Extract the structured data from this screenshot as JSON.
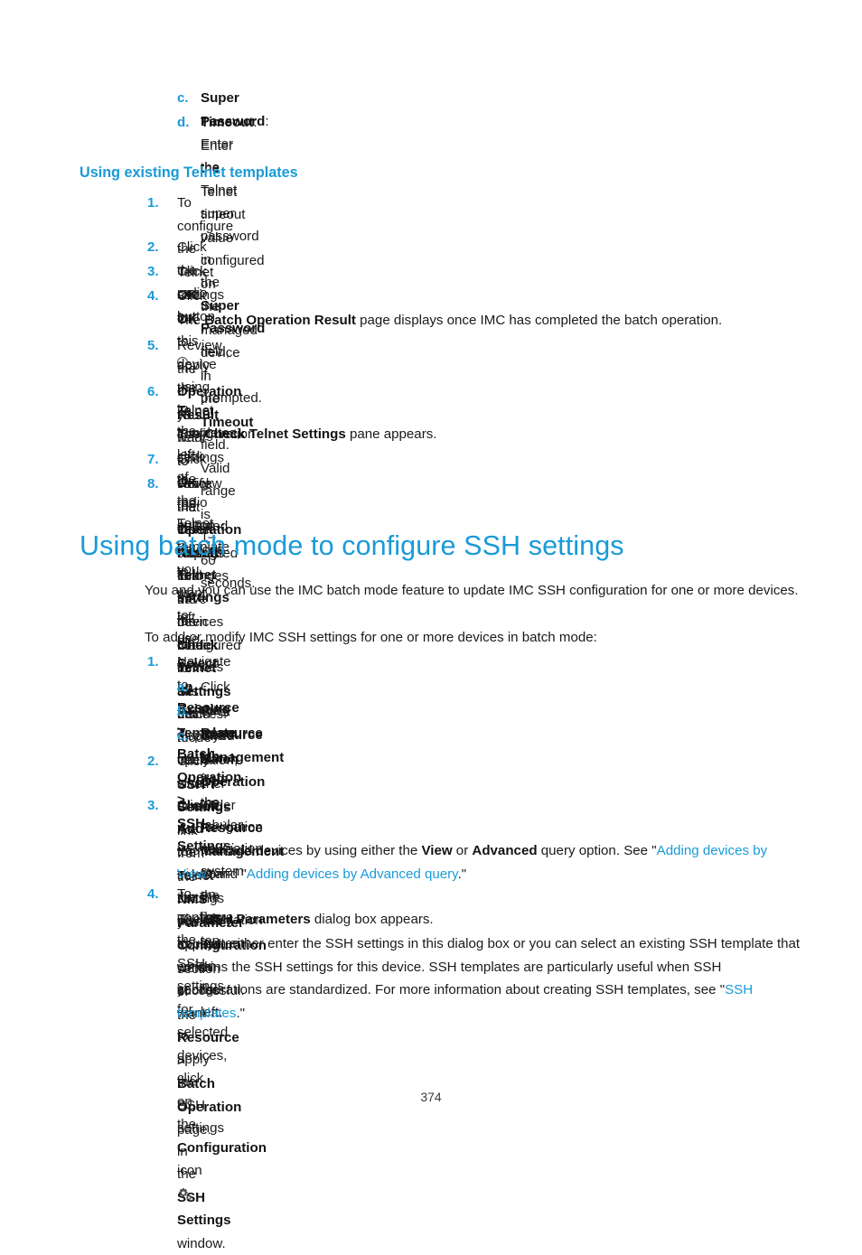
{
  "page": {
    "number": "374"
  },
  "sections": {
    "telnet_sub_items": {
      "c": {
        "marker": "c.",
        "lead": "Super Password",
        "text_1": ": Enter the Telnet super password in the ",
        "bold_2": "Super Password",
        "text_3": " field, if prompted."
      },
      "d": {
        "marker": "d.",
        "lead": "Timeout",
        "text_1": ": Enter the Telnet timeout value configured on the managed device in the ",
        "bold_2": "Timeout",
        "text_3": " field. Valid range is 1–60 seconds."
      }
    },
    "telnet_templates": {
      "heading": "Using existing Telnet templates",
      "items": {
        "i1": {
          "marker": "1.",
          "text_1": "To configure the Telnet settings for this device using Telnet templates, click the radio button",
          "icon": "radio-button-icon",
          "text_2": "to the left of ",
          "bold_3": "Select an Existing Template",
          "text_4": "."
        },
        "i2": {
          "marker": "2.",
          "text_1": "Click the radio button",
          "icon": "radio-button-icon",
          "text_2": "to the left of the Telnet template you want to use."
        },
        "i3": {
          "marker": "3.",
          "text_1": "Click ",
          "bold_2": "OK",
          "text_3": "."
        },
        "i4": {
          "marker": "4.",
          "text_1": "Click ",
          "bold_2": "OK",
          "text_3": " to apply the Telnet configuration settings to the selected devices."
        },
        "i4_note": {
          "text_1": "The ",
          "bold_2": "Batch Operation Result",
          "text_3": " page displays once IMC has completed the batch operation."
        },
        "i5": {
          "marker": "5.",
          "text_1": "Review the ",
          "bold_2": "Operation Result",
          "text_3": " field to verify that the requested changes have been made for all devices."
        },
        "i6": {
          "marker": "6.",
          "text_1": "If you want to check the Telnet settings for the devices configured in this batch mode operation, click ",
          "bold_2": "Check",
          "text_3": "."
        },
        "i6_note": {
          "text_1": "The ",
          "bold_2": "Check Telnet Settings",
          "text_3": " pane appears."
        },
        "i7": {
          "marker": "7.",
          "text_1": "Click ",
          "bold_2": "OK",
          "text_3": " to check the ",
          "bold_4": "Telnet settings",
          "text_5": " for all devices in the displayed list."
        },
        "i8": {
          "marker": "8.",
          "text_1": "Review the ",
          "bold_2": "Operation Result",
          "text_3": " field in the ",
          "bold_4": "Check Telnet Settings",
          "text_5": " List to verify whether or not the Telnet settings you applied were successful."
        }
      }
    },
    "ssh_batch": {
      "heading": "Using batch mode to configure SSH settings",
      "intro_1": "You and you can use the IMC batch mode feature to update IMC SSH configuration for one or more devices.",
      "intro_2": "To add or modify IMC SSH settings for one or more devices in batch mode:",
      "items": {
        "i1": {
          "marker": "1.",
          "text_1": "Navigate to ",
          "bold_2": "Resource > Batch Operation > SSH Settings",
          "text_3": ":"
        },
        "i1a": {
          "marker": "a.",
          "text_1": "Click the ",
          "bold_2": "Resource",
          "text_3": " tab from the tabular navigation system on the top."
        },
        "i1b": {
          "marker": "b.",
          "text_1": "Click ",
          "bold_2": "Resource Management",
          "text_3": " on the navigation tree on the left."
        },
        "i1c": {
          "marker": "c.",
          "text_1": "Click ",
          "bold_2": "Batch Operation",
          "text_3": " under ",
          "bold_4": "Resource Management",
          "text_5": " from the navigation system on the left."
        },
        "i2": {
          "marker": "2.",
          "text_1": "Click ",
          "bold_2": "SSH Settings",
          "text_3": " link from the ",
          "bold_4": "NMS Parameter Configuration",
          "text_5": " section of the ",
          "bold_6": "Resource > Batch Operation",
          "text_7": " page."
        },
        "i3": {
          "marker": "3.",
          "text_1": "Click ",
          "bold_2": "Add",
          "text_3": " to select the devices to which you want to apply the SSH settings in the ",
          "bold_4": "SSH Settings",
          "text_5": " window."
        },
        "i3_note": {
          "text_1": "You can add devices by using either the ",
          "bold_2": "View",
          "text_3": " or ",
          "bold_4": "Advanced",
          "text_5": " query option. See \"",
          "link_6": "Adding devices by View",
          "text_7": "\" and \"",
          "link_8": "Adding devices by Advanced query",
          "text_9": ".\""
        },
        "i4": {
          "marker": "4.",
          "text_1": "To configure the SSH settings for selected devices, click on the ",
          "bold_2": "Configuration",
          "text_3": " icon ",
          "icon": "configuration-gear-icon",
          "text_4": "."
        },
        "i4_note1": {
          "text_1": "The ",
          "bold_2": "SSH Parameters",
          "text_3": " dialog box appears."
        },
        "i4_note2": {
          "text_1": "You can either enter the SSH settings in this dialog box or you can select an existing SSH template that contains the SSH settings for this device. SSH templates are particularly useful when SSH configurations are standardized. For more information about creating SSH templates, see \"",
          "link_2": "SSH templates",
          "text_3": ".\""
        }
      }
    }
  },
  "colors": {
    "accent_blue": "#1a9ad7",
    "body_text": "#1a1a1a"
  }
}
